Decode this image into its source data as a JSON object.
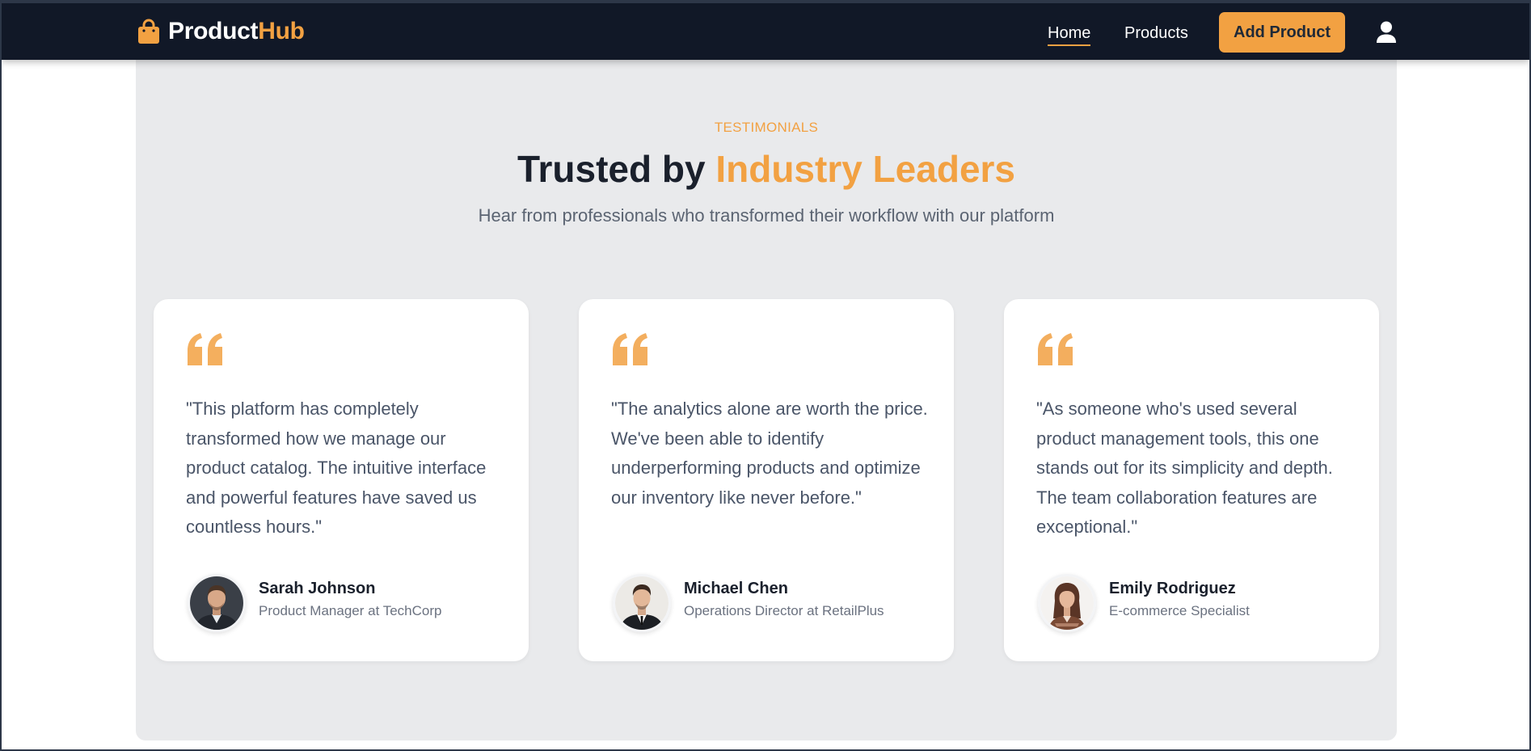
{
  "navbar": {
    "brand_part1": "Product",
    "brand_part2": "Hub",
    "brand_icon": "shopping-bag-icon",
    "links": [
      {
        "label": "Home",
        "active": true
      },
      {
        "label": "Products",
        "active": false
      }
    ],
    "add_button_label": "Add Product",
    "user_icon": "user-icon"
  },
  "section": {
    "eyebrow": "TESTIMONIALS",
    "heading_part1": "Trusted by ",
    "heading_part2": "Industry Leaders",
    "subtitle": "Hear from professionals who transformed their workflow with our platform"
  },
  "testimonials": [
    {
      "quote": "\"This platform has completely transformed how we manage our product catalog. The intuitive interface and powerful features have saved us countless hours.\"",
      "name": "Sarah Johnson",
      "role": "Product Manager at TechCorp"
    },
    {
      "quote": "\"The analytics alone are worth the price. We've been able to identify underperforming products and optimize our inventory like never before.\"",
      "name": "Michael Chen",
      "role": "Operations Director at RetailPlus"
    },
    {
      "quote": "\"As someone who's used several product management tools, this one stands out for its simplicity and depth. The team collaboration features are exceptional.\"",
      "name": "Emily Rodriguez",
      "role": "E-commerce Specialist"
    }
  ],
  "colors": {
    "accent": "#f2a142",
    "navbar_bg": "#111827",
    "section_bg": "#e9eaec",
    "heading": "#1a202c",
    "body_text": "#4a5568"
  }
}
